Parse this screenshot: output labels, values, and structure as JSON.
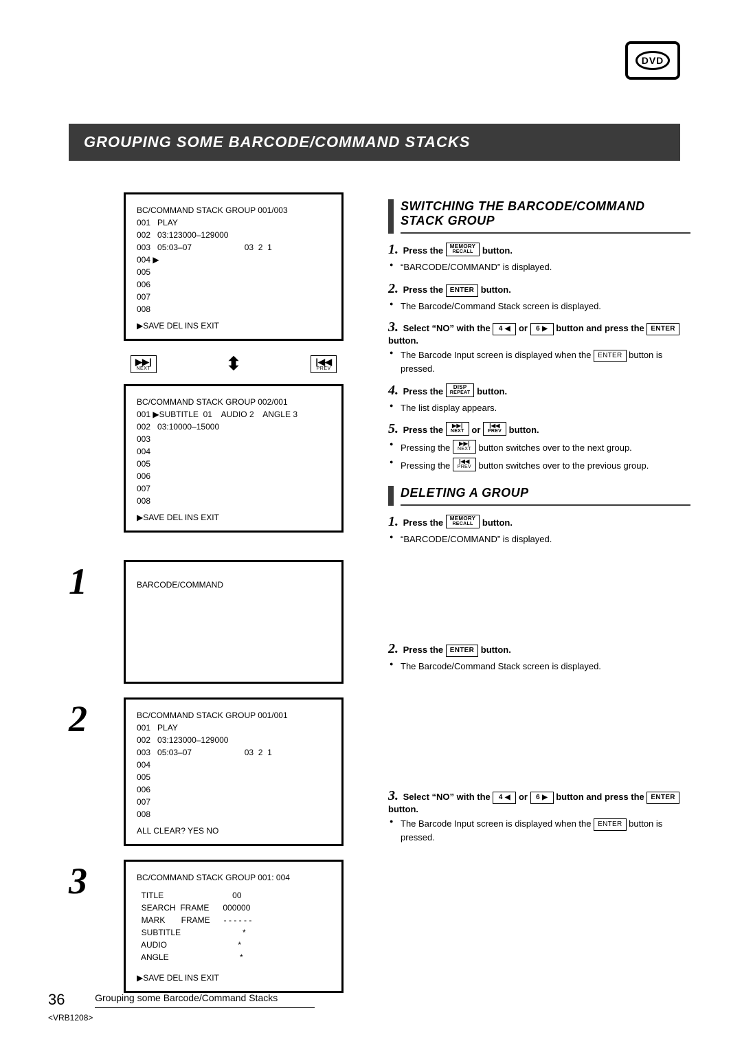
{
  "logo_text": "DVD",
  "page_title": "GROUPING SOME BARCODE/COMMAND STACKS",
  "panelA": {
    "header": "BC/COMMAND STACK  GROUP  001/003",
    "l1": "001   PLAY",
    "l2": "002   03:123000–129000",
    "l3": "003   05:03–07                       03  2  1",
    "l4": "004 ▶",
    "l5": "005",
    "l6": "006",
    "l7": "007",
    "l8": "008",
    "foot": "    ▶SAVE   DEL    INS    EXIT"
  },
  "arrow_next_sym": "▶▶|",
  "arrow_next_lbl": "NEXT",
  "arrow_updown": "⬍",
  "arrow_prev_sym": "|◀◀",
  "arrow_prev_lbl": "PREV",
  "panelB": {
    "header": "BC/COMMAND STACK  GROUP  002/001",
    "l1": "001 ▶SUBTITLE  01    AUDIO 2    ANGLE 3",
    "l2": "002   03:10000–15000",
    "l3": "003",
    "l4": "004",
    "l5": "005",
    "l6": "006",
    "l7": "007",
    "l8": "008",
    "foot": "    ▶SAVE   DEL    INS    EXIT"
  },
  "panel1": {
    "text": "BARCODE/COMMAND"
  },
  "panel2": {
    "header": "BC/COMMAND STACK  GROUP  001/001",
    "l1": "001   PLAY",
    "l2": "002   03:123000–129000",
    "l3": "003   05:03–07                       03  2  1",
    "l4": "004",
    "l5": "005",
    "l6": "006",
    "l7": "007",
    "l8": "008",
    "foot": "        ALL  CLEAR?   YES   NO"
  },
  "panel3": {
    "header": "BC/COMMAND STACK  GROUP  001: 004",
    "l1": "  TITLE                              00",
    "l2": "  SEARCH  FRAME      000000",
    "l3": "  MARK       FRAME      - - - - - -",
    "l4": "  SUBTITLE                           *",
    "l5": "  AUDIO                               *",
    "l6": "  ANGLE                               *",
    "foot": "  ▶SAVE   DEL    INS    EXIT"
  },
  "nums": {
    "n1": "1",
    "n2": "2",
    "n3": "3"
  },
  "sectA_title": "SWITCHING THE BARCODE/COMMAND STACK GROUP",
  "sectB_title": "DELETING A GROUP",
  "keys": {
    "memory_top": "MEMORY",
    "memory_bot": "RECALL",
    "enter": "ENTER",
    "left4": "4 ◀",
    "right6": "6 ▶",
    "disp_top": "DISP",
    "disp_bot": "REPEAT",
    "next_sym": "▶▶|",
    "next_lbl": "NEXT",
    "prev_sym": "|◀◀",
    "prev_lbl": "PREV"
  },
  "sA": {
    "s1_pre": "Press the ",
    "s1_post": " button.",
    "s1_b1": "“BARCODE/COMMAND” is displayed.",
    "s2_pre": "Press the ",
    "s2_post": " button.",
    "s2_b1": "The Barcode/Command Stack screen is displayed.",
    "s3_a": "Select “NO” with the ",
    "s3_b": " or ",
    "s3_c": " button and press the ",
    "s3_d": " button.",
    "s3_b1a": "The Barcode Input screen is displayed when the ",
    "s3_b1b": " button is pressed.",
    "s4_pre": "Press the ",
    "s4_post": " button.",
    "s4_b1": "The list display appears.",
    "s5_a": "Press the ",
    "s5_b": " or ",
    "s5_c": " button.",
    "s5_b1a": "Pressing the ",
    "s5_b1b": " button switches over to the next group.",
    "s5_b2a": "Pressing the ",
    "s5_b2b": " button switches over to the previous group."
  },
  "sB": {
    "s1_pre": "Press the ",
    "s1_post": " button.",
    "s1_b1": "“BARCODE/COMMAND” is displayed.",
    "s2_pre": "Press the ",
    "s2_post": " button.",
    "s2_b1": "The Barcode/Command Stack screen is displayed.",
    "s3_a": "Select “NO” with the ",
    "s3_b": " or ",
    "s3_c": " button and press the ",
    "s3_d": " button.",
    "s3_b1a": "The Barcode Input screen is displayed when the ",
    "s3_b1b": " button is pressed."
  },
  "footer": {
    "page": "36",
    "text": "Grouping some Barcode/Command Stacks",
    "code": "<VRB1208>"
  }
}
